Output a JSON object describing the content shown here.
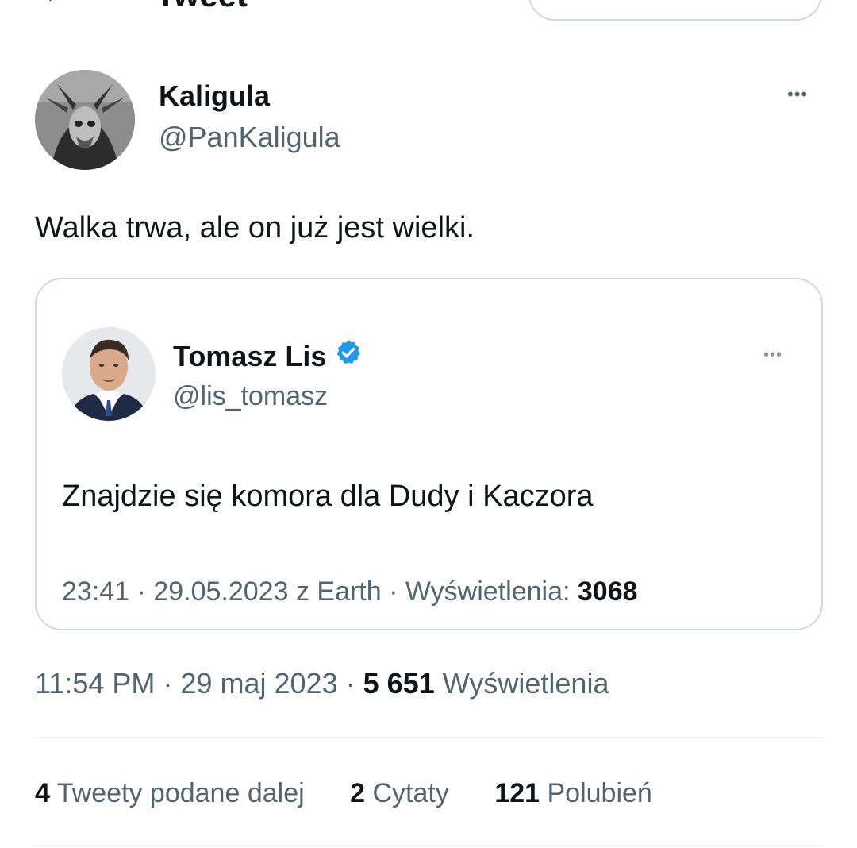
{
  "header": {
    "title": "Tweet"
  },
  "tweet": {
    "author_name": "Kaligula",
    "author_handle": "@PanKaligula",
    "more_label": "•••",
    "text": "Walka trwa, ale on już jest wielki.",
    "time": "11:54 PM",
    "date": "29 maj 2023",
    "views_count": "5 651",
    "views_label": "Wyświetlenia",
    "separator": "·"
  },
  "quoted": {
    "author_name": "Tomasz Lis",
    "author_handle": "@lis_tomasz",
    "verified": true,
    "more_label": "•••",
    "text": "Znajdzie się komora dla Dudy i Kaczora",
    "time": "23:41",
    "date": "29.05.2023 z Earth",
    "views_label": "Wyświetlenia:",
    "views_count": "3068",
    "separator": "·"
  },
  "stats": [
    {
      "count": "4",
      "label": "Tweety podane dalej"
    },
    {
      "count": "2",
      "label": "Cytaty"
    },
    {
      "count": "121",
      "label": "Polubień"
    }
  ],
  "colors": {
    "text": "#0f1419",
    "secondary": "#536471",
    "border": "#cfd9de",
    "verified": "#1d9bf0"
  }
}
